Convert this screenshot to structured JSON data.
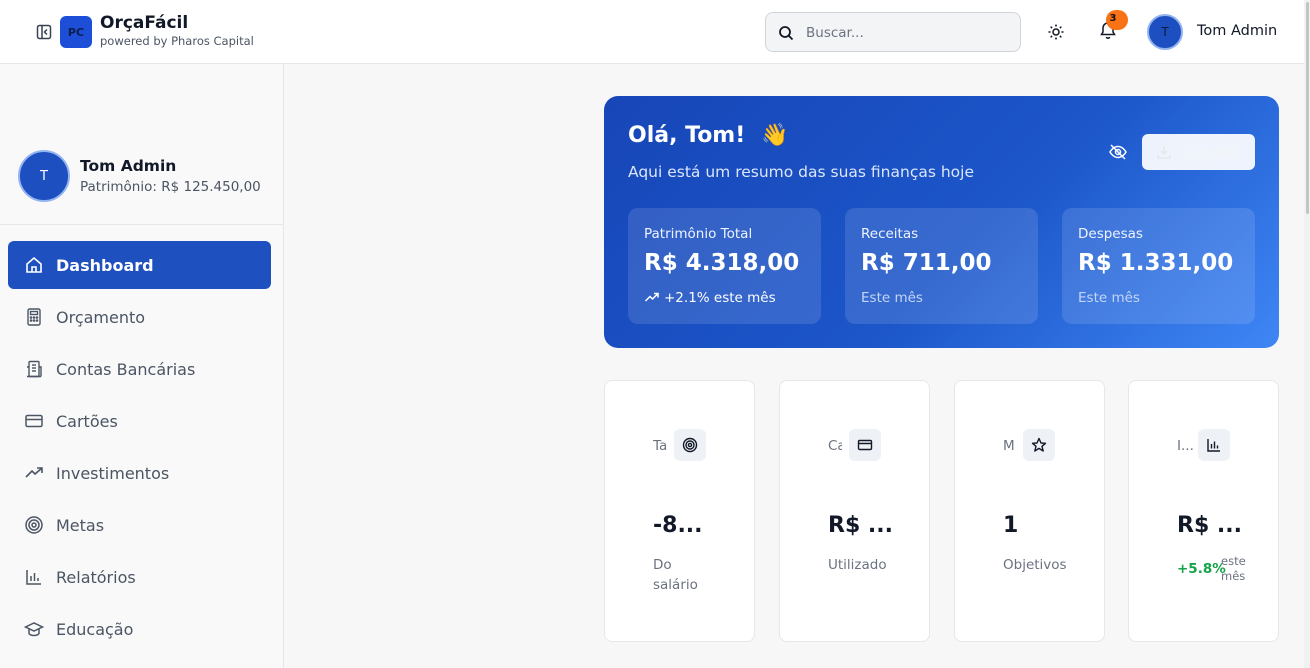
{
  "header": {
    "logo_initials": "PC",
    "app_name": "OrçaFácil",
    "tagline": "powered by Pharos Capital",
    "search_placeholder": "Buscar...",
    "notification_count": "3",
    "avatar_initial": "T",
    "user_name": "Tom Admin"
  },
  "sidebar": {
    "avatar_initial": "T",
    "user_name": "Tom Admin",
    "net_worth": "Patrimônio: R$ 125.450,00",
    "items": [
      {
        "label": "Dashboard",
        "icon": "home-icon",
        "active": true
      },
      {
        "label": "Orçamento",
        "icon": "calculator-icon"
      },
      {
        "label": "Contas Bancárias",
        "icon": "bank-icon"
      },
      {
        "label": "Cartões",
        "icon": "credit-card-icon"
      },
      {
        "label": "Investimentos",
        "icon": "trending-up-icon"
      },
      {
        "label": "Metas",
        "icon": "target-icon"
      },
      {
        "label": "Relatórios",
        "icon": "bar-chart-icon"
      },
      {
        "label": "Educação",
        "icon": "graduation-cap-icon"
      }
    ]
  },
  "hero": {
    "greeting": "Olá, Tom!",
    "emoji": "👋",
    "subtitle": "Aqui está um resumo das suas finanças hoje",
    "export_label": "Exportar",
    "stats": [
      {
        "label": "Patrimônio Total",
        "value": "R$ 4.318,00",
        "note": "+2.1% este mês"
      },
      {
        "label": "Receitas",
        "value": "R$ 711,00",
        "note": "Este mês"
      },
      {
        "label": "Despesas",
        "value": "R$ 1.331,00",
        "note": "Este mês"
      }
    ]
  },
  "cards": [
    {
      "label": "Ta",
      "icon": "target-icon",
      "value": "-8...",
      "sub_line1": "Do",
      "sub_line2": "salário"
    },
    {
      "label": "Ca",
      "icon": "credit-card-icon",
      "value": "R$ ...",
      "sub_line1": "Utilizado"
    },
    {
      "label": "M",
      "icon": "star-icon",
      "value": "1",
      "sub_line1": "Objetivos"
    },
    {
      "label": "I...",
      "icon": "bar-chart-icon",
      "value": "R$ ...",
      "trend": "+5.8%",
      "trend_note_line1": "este",
      "trend_note_line2": "mês"
    }
  ],
  "colors": {
    "primary": "#1e50c0",
    "badge": "#f97316",
    "positive": "#16a34a"
  }
}
